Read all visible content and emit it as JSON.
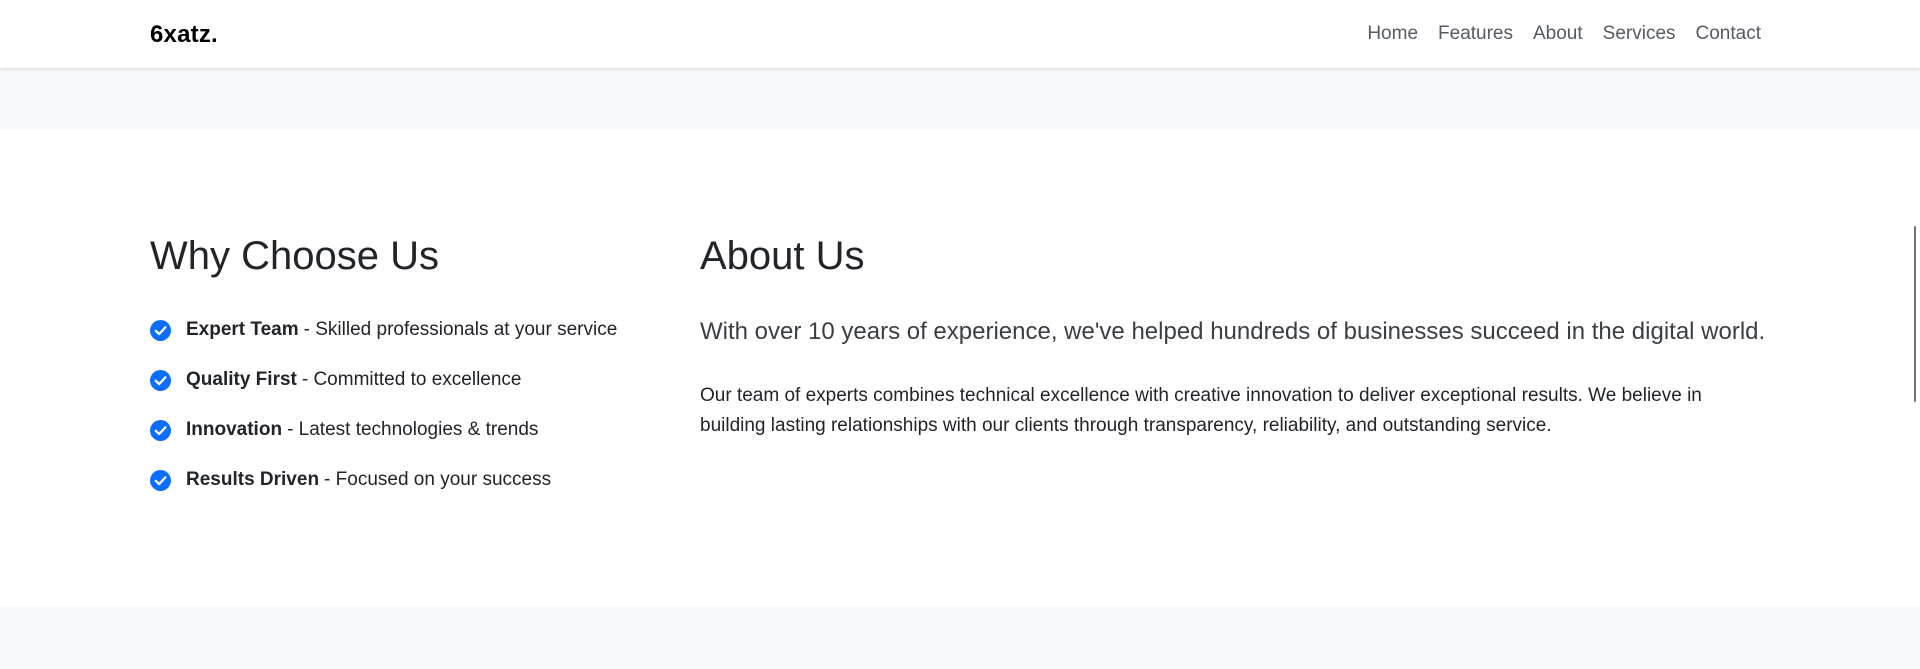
{
  "brand": "6xatz.",
  "nav": {
    "items": [
      "Home",
      "Features",
      "About",
      "Services",
      "Contact"
    ]
  },
  "why": {
    "title": "Why Choose Us",
    "items": [
      {
        "bold": "Expert Team",
        "text": "- Skilled professionals at your service"
      },
      {
        "bold": "Quality First",
        "text": "- Committed to excellence"
      },
      {
        "bold": "Innovation",
        "text": "- Latest technologies & trends"
      },
      {
        "bold": "Results Driven",
        "text": "- Focused on your success"
      }
    ]
  },
  "about": {
    "title": "About Us",
    "lead": "With over 10 years of experience, we've helped hundreds of businesses succeed in the digital world.",
    "body": "Our team of experts combines technical excellence with creative innovation to deliver exceptional results. We believe in building lasting relationships with our clients through transparency, reliability, and outstanding service."
  },
  "colors": {
    "accent": "#0d6efd",
    "band": "#f8f9fa"
  },
  "icons": {
    "check": "check-circle-icon"
  }
}
